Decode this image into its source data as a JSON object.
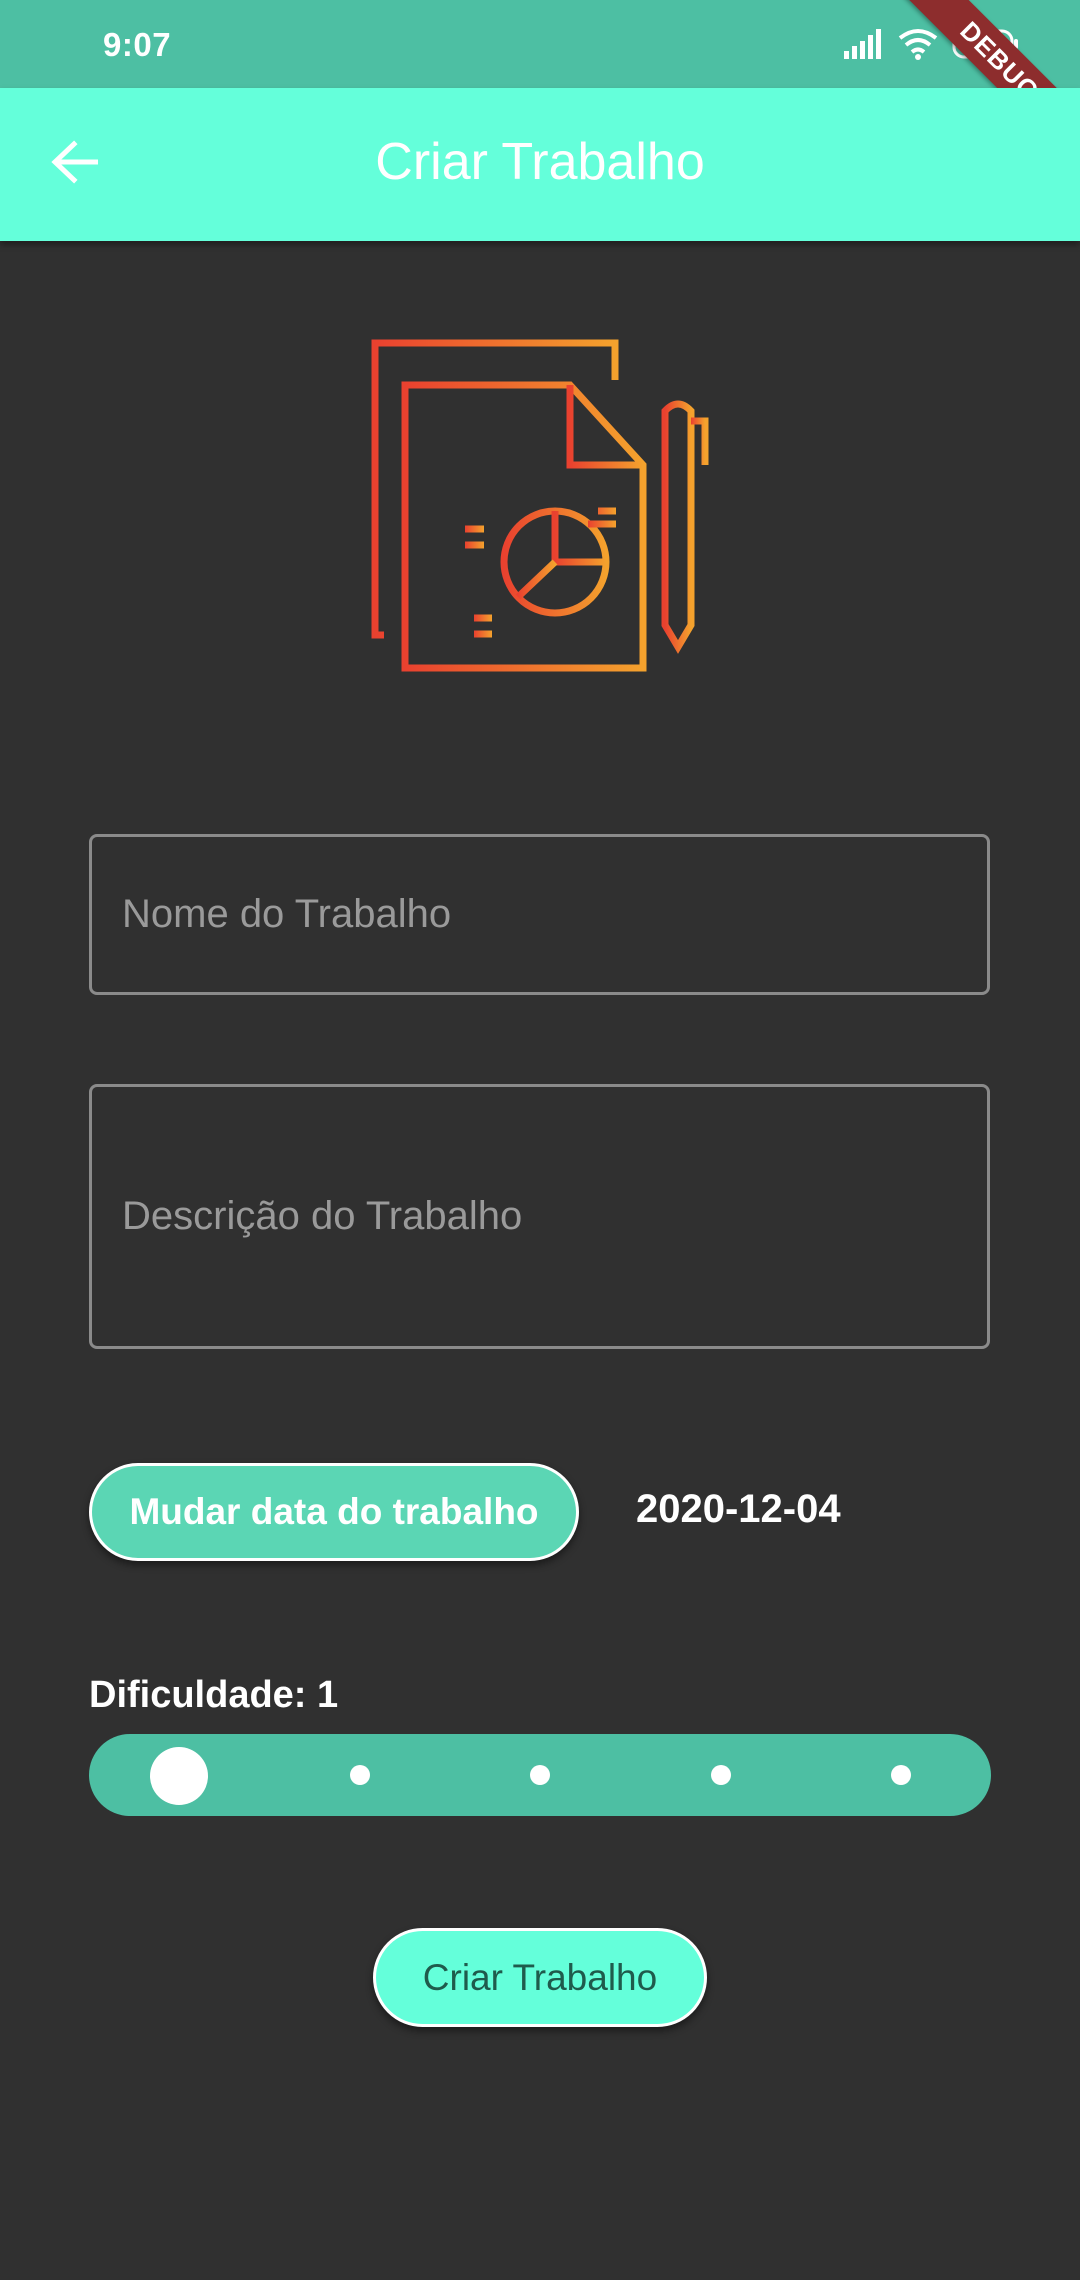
{
  "status_bar": {
    "time": "9:07",
    "debug_label": "DEBUG",
    "background_color": "#4dbfa3"
  },
  "app_bar": {
    "title": "Criar Trabalho",
    "back_icon": "arrow-back-icon",
    "background_color": "#64ffda"
  },
  "illustration": {
    "icon": "document-chart-pen-icon"
  },
  "form": {
    "name_placeholder": "Nome do Trabalho",
    "name_value": "",
    "description_placeholder": "Descrição do Trabalho",
    "description_value": "",
    "date_button_label": "Mudar data do trabalho",
    "date_value": "2020-12-04",
    "difficulty_label": "Dificuldade: 1",
    "difficulty": {
      "value": 1,
      "min": 1,
      "max": 5,
      "steps": 5
    },
    "submit_label": "Criar Trabalho"
  },
  "colors": {
    "accent": "#64ffda",
    "slider": "#4dbfa3",
    "button": "#5bd6b4",
    "background": "#303030"
  }
}
